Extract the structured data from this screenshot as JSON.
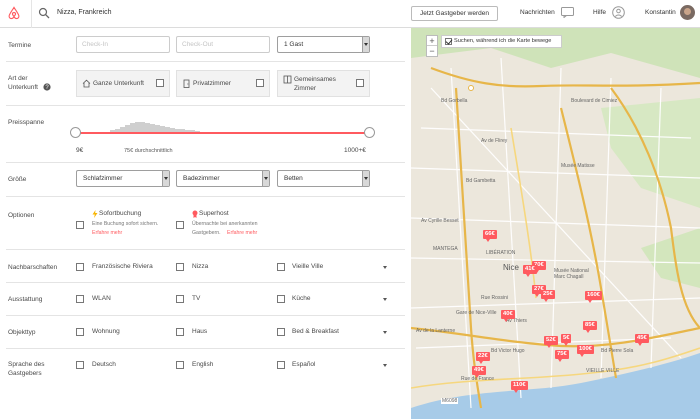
{
  "header": {
    "location": "Nizza, Frankreich",
    "host_button": "Jetzt Gastgeber werden",
    "messages": "Nachrichten",
    "help": "Hilfe",
    "user": "Konstantin",
    "brand_color": "#ff5a5f"
  },
  "filters": {
    "dates": {
      "label": "Termine",
      "checkin_placeholder": "Check-In",
      "checkout_placeholder": "Check-Out",
      "guests": "1 Gast"
    },
    "room_type": {
      "label_line1": "Art der",
      "label_line2": "Unterkunft",
      "options": [
        {
          "label": "Ganze Unterkunft",
          "icon": "house-icon"
        },
        {
          "label": "Privatzimmer",
          "icon": "door-icon"
        },
        {
          "label_line1": "Gemeinsames",
          "label_line2": "Zimmer",
          "icon": "shared-room-icon"
        }
      ]
    },
    "price": {
      "label": "Preisspanne",
      "min": "9€",
      "max": "1000+€",
      "average": "75€ durchschnittlich",
      "histogram": [
        2,
        3,
        5,
        7,
        9,
        10,
        10,
        9,
        8,
        7,
        6,
        5,
        4,
        3,
        3,
        2,
        2,
        1
      ]
    },
    "size": {
      "label": "Größe",
      "bedrooms": "Schlafzimmer",
      "bathrooms": "Badezimmer",
      "beds": "Betten"
    },
    "options": {
      "label": "Optionen",
      "instant": {
        "title": "Sofortbuchung",
        "desc": "Eine Buchung sofort sichern.",
        "link": "Erfahre mehr"
      },
      "superhost": {
        "title": "Superhost",
        "desc_line1": "Übernachte bei anerkannten",
        "desc_line2": "Gastgebern.",
        "link": "Erfahre mehr"
      }
    },
    "neighborhoods": {
      "label": "Nachbarschaften",
      "items": [
        "Französische Riviera",
        "Nizza",
        "Vieille Ville"
      ]
    },
    "amenities": {
      "label": "Ausstattung",
      "items": [
        "WLAN",
        "TV",
        "Küche"
      ]
    },
    "property_type": {
      "label": "Objekttyp",
      "items": [
        "Wohnung",
        "Haus",
        "Bed & Breakfast"
      ]
    },
    "languages": {
      "label_line1": "Sprache des",
      "label_line2": "Gastgebers",
      "items": [
        "Deutsch",
        "English",
        "Español"
      ]
    }
  },
  "map": {
    "zoom_in": "+",
    "zoom_out": "−",
    "search_move": "Suchen, während ich die Karte bewege",
    "pins": [
      "66€",
      "70€",
      "41€",
      "27€",
      "25€",
      "160€",
      "40€",
      "85€",
      "52€",
      "5€",
      "45€",
      "100€",
      "75€",
      "22€",
      "49€",
      "110€"
    ],
    "labels": [
      "Nice",
      "Musée National Marc Chagall",
      "Musée Matisse",
      "LIBÉRATION",
      "Gare de Nice-Ville",
      "Boulevard de Cimiez",
      "Bd Gorbella",
      "Av Cyrille Besset",
      "Av de la Lanterne",
      "Av Thiers",
      "Bd Victor Hugo",
      "Bd Gambetta",
      "Av de Flirey",
      "Bd Pierre Sola",
      "VIEILLE VILLE",
      "MANTEGA",
      "Rue de France",
      "Rue Rossini",
      "M6098"
    ]
  }
}
